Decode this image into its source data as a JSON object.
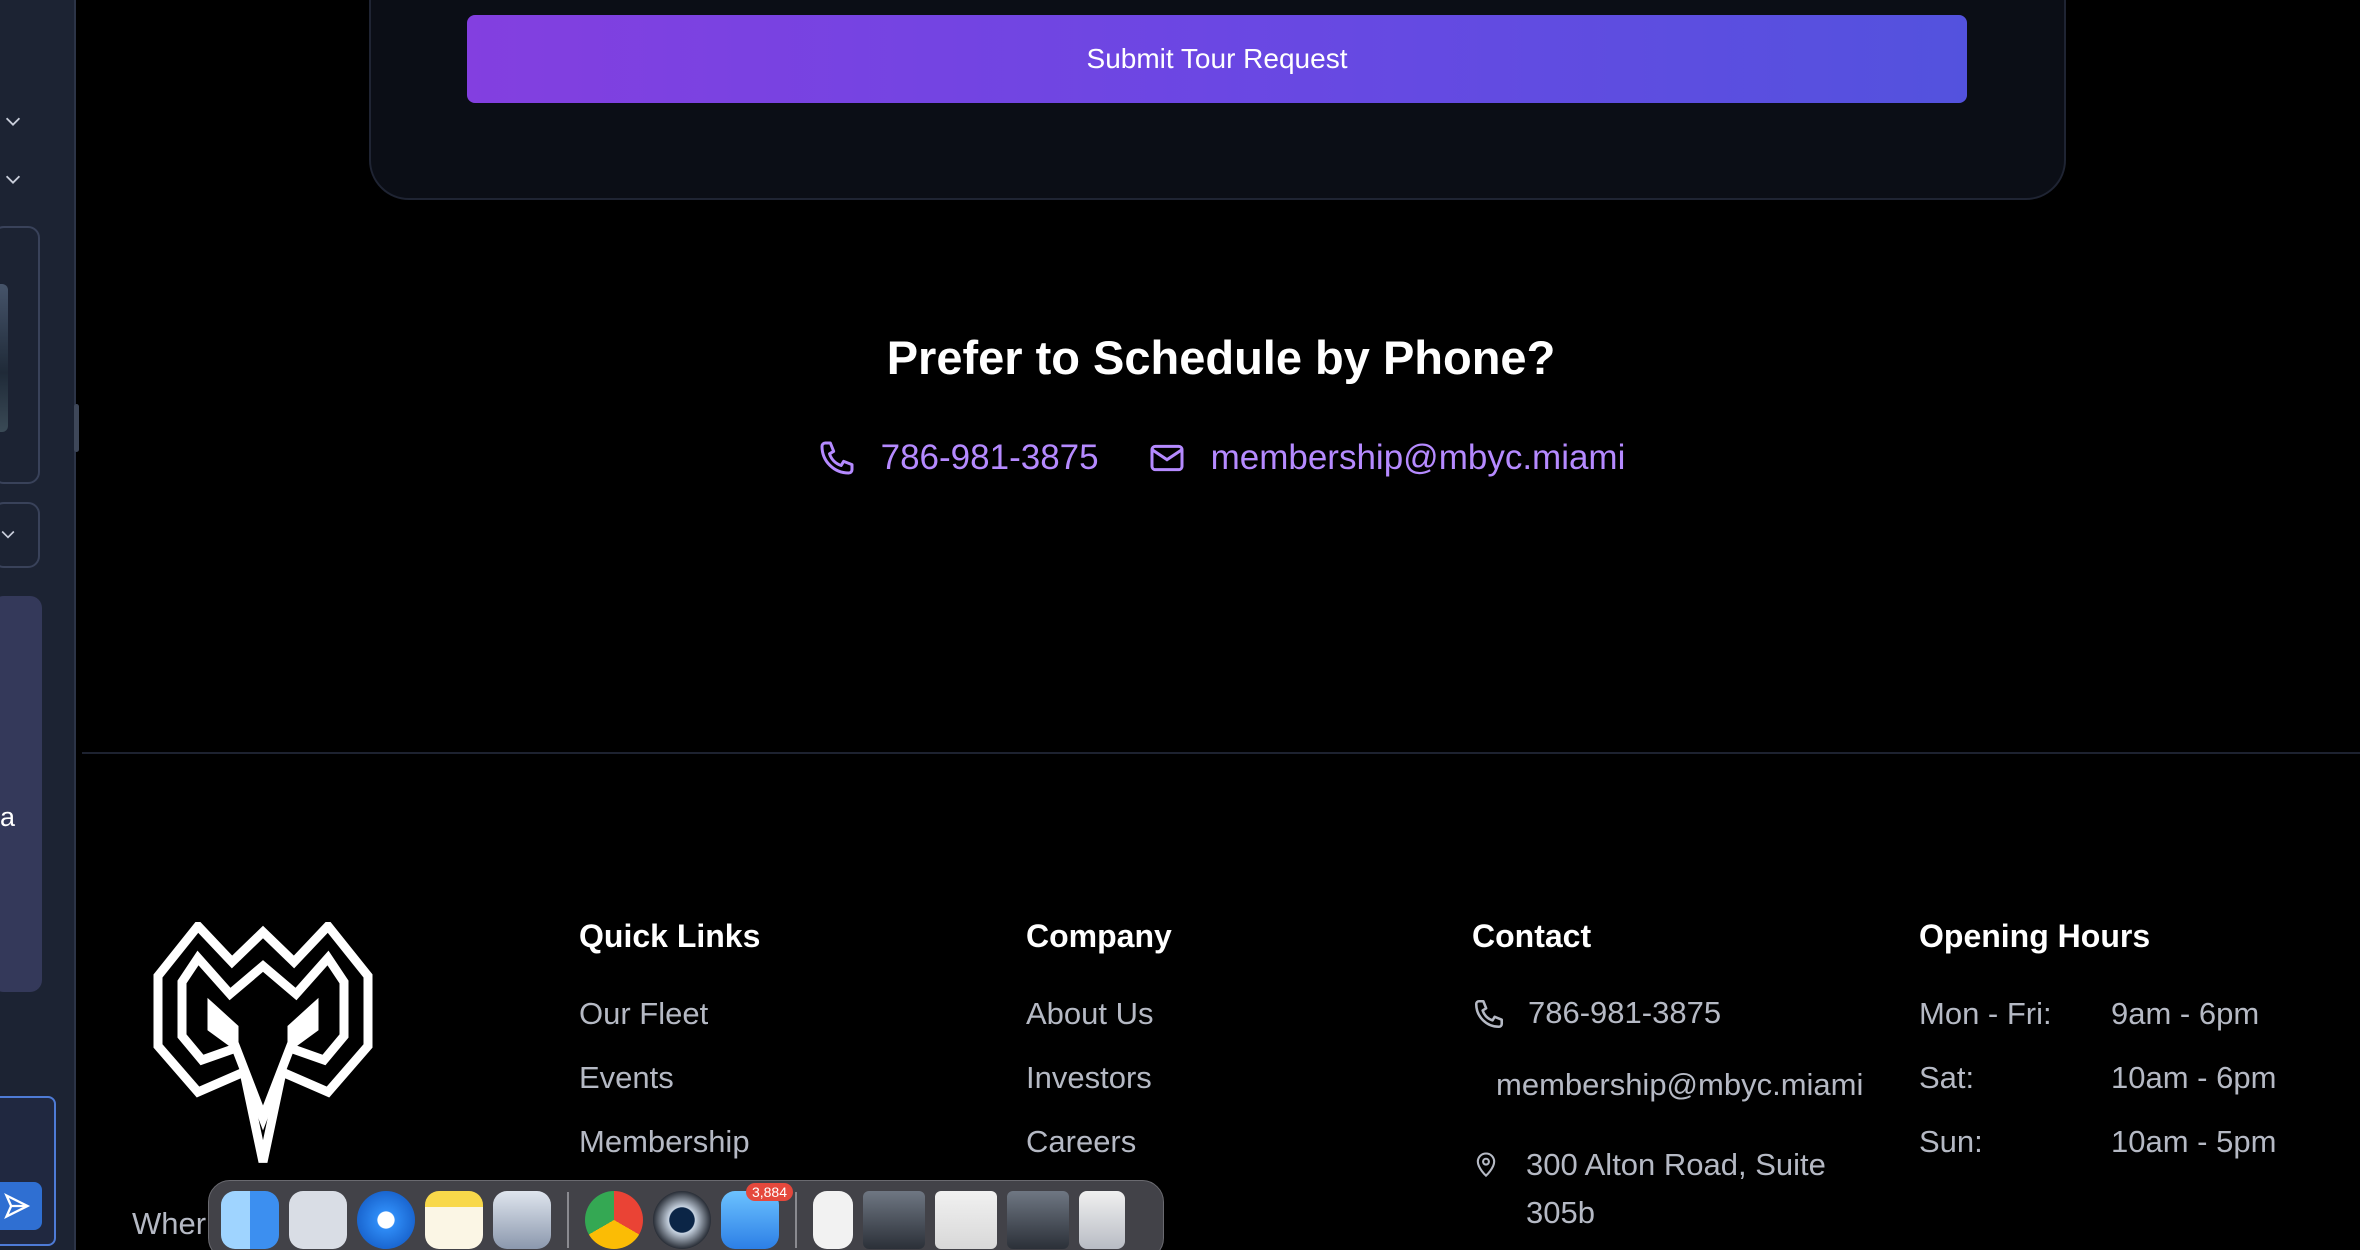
{
  "form": {
    "submit_label": "Submit Tour Request"
  },
  "phone_section": {
    "title": "Prefer to Schedule by Phone?",
    "phone": "786-981-3875",
    "email": "membership@mbyc.miami"
  },
  "footer": {
    "quick_links": {
      "heading": "Quick Links",
      "items": [
        "Our Fleet",
        "Events",
        "Membership"
      ]
    },
    "company": {
      "heading": "Company",
      "items": [
        "About Us",
        "Investors",
        "Careers"
      ]
    },
    "contact": {
      "heading": "Contact",
      "phone": "786-981-3875",
      "email": "membership@mbyc.miami",
      "address_line1": "300 Alton Road, Suite",
      "address_line2": "305b"
    },
    "hours": {
      "heading": "Opening Hours",
      "rows": [
        {
          "day": "Mon - Fri:",
          "time": "9am - 6pm"
        },
        {
          "day": "Sat:",
          "time": "10am - 6pm"
        },
        {
          "day": "Sun:",
          "time": "10am - 5pm"
        }
      ]
    }
  },
  "sidebar": {
    "tile_letter": "a"
  },
  "bottom_text": "Wher",
  "dock": {
    "mail_badge": "3,884"
  }
}
